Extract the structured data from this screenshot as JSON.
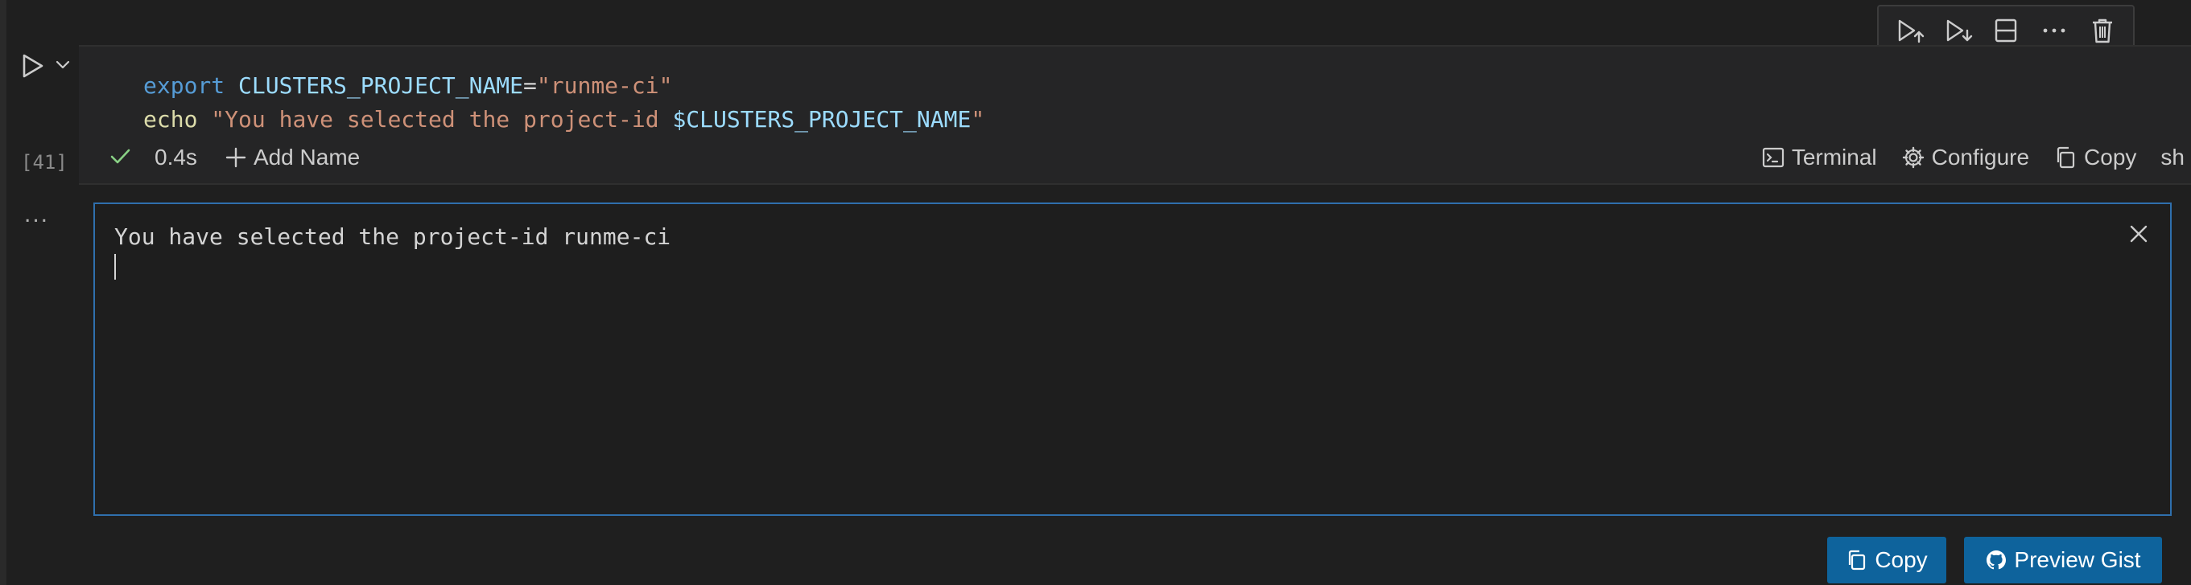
{
  "cell": {
    "execution_count": "[41]",
    "code_lines": [
      {
        "keyword": "export",
        "variable": "CLUSTERS_PROJECT_NAME",
        "operator": "=",
        "string": "\"runme-ci\""
      },
      {
        "keyword": "echo",
        "string_part": "\"You have selected the project-id ",
        "var_ref": "$CLUSTERS_PROJECT_NAME",
        "string_end": "\""
      }
    ],
    "status": {
      "duration": "0.4s",
      "add_name_label": "Add Name",
      "terminal_label": "Terminal",
      "configure_label": "Configure",
      "copy_label": "Copy",
      "language": "sh"
    }
  },
  "toolbar": {
    "icons": [
      "run-above-icon",
      "run-below-icon",
      "split-cell-icon",
      "more-icon",
      "delete-icon"
    ]
  },
  "output": {
    "ellipsis": "...",
    "text": "You have selected the project-id runme-ci"
  },
  "actions": {
    "copy_label": "Copy",
    "preview_gist_label": "Preview Gist"
  },
  "colors": {
    "background": "#1f1f1f",
    "cell_background": "#252526",
    "keyword": "#569cd6",
    "variable": "#9cdcfe",
    "string": "#ce9178",
    "command": "#dcdcaa",
    "success_check": "#89d185",
    "output_border": "#2f6fad",
    "button": "#0e639c"
  }
}
